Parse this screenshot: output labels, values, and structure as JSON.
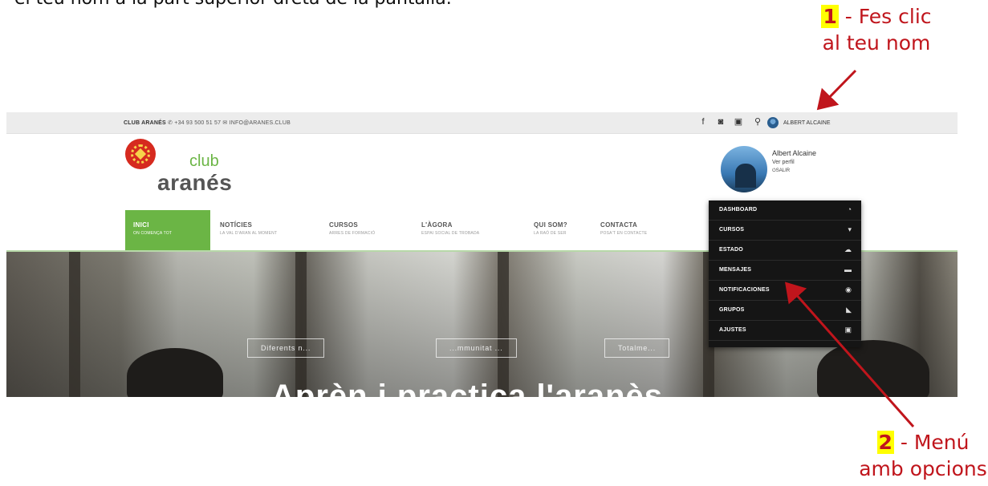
{
  "doc": {
    "text_top": "el teu nom a la part superior dreta de la pantalla."
  },
  "callouts": [
    {
      "number": "1",
      "text_line1": " - Fes clic",
      "text_line2": "al teu nom"
    },
    {
      "number": "2",
      "text_line1": " - Menú",
      "text_line2": "amb opcions"
    }
  ],
  "colors": {
    "callout": "#c0151c",
    "highlight": "#ffff00",
    "nav_active": "#6bb545"
  },
  "site": {
    "topbar": {
      "brand": "CLUB ARANÉS",
      "phone": "+34 93 500 51 57",
      "email": "INFO@ARANES.CLUB",
      "user_name": "ALBERT ALCAINE"
    },
    "logo": {
      "club": "club",
      "aranes": "aranés"
    },
    "profile": {
      "name": "Albert Alcaine",
      "view_profile": "Ver perfil",
      "logout": "SALIR"
    },
    "nav": [
      {
        "title": "INICI",
        "subtitle": "ON COMENÇA TOT"
      },
      {
        "title": "NOTÍCIES",
        "subtitle": "LA VAL D'ARAN AL MOMENT"
      },
      {
        "title": "CURSOS",
        "subtitle": "ARRES DE FORMACIÓ"
      },
      {
        "title": "L'ÀGORA",
        "subtitle": "ESPAI SOCIAL DE TROBADA"
      },
      {
        "title": "QUI SOM?",
        "subtitle": "LA RAÓ DE SER"
      },
      {
        "title": "CONTACTA",
        "subtitle": "POSA'T EN CONTACTE"
      }
    ],
    "dropdown": [
      {
        "label": "DASHBOARD",
        "icon": "dashboard-icon",
        "glyph": "◔"
      },
      {
        "label": "CURSOS",
        "icon": "courses-icon",
        "glyph": "▾"
      },
      {
        "label": "ESTADO",
        "icon": "status-icon",
        "glyph": "☁"
      },
      {
        "label": "MENSAJES",
        "icon": "messages-icon",
        "glyph": "▬"
      },
      {
        "label": "NOTIFICACIONES",
        "icon": "notifications-icon",
        "glyph": "◉"
      },
      {
        "label": "GRUPOS",
        "icon": "groups-icon",
        "glyph": "◣"
      },
      {
        "label": "AJUSTES",
        "icon": "settings-icon",
        "glyph": "▣"
      }
    ],
    "hero": {
      "pills": [
        "Diferents n...",
        "...mmunitat ...",
        "Totalme..."
      ],
      "title": "Aprèn i practica l'aranès"
    }
  }
}
